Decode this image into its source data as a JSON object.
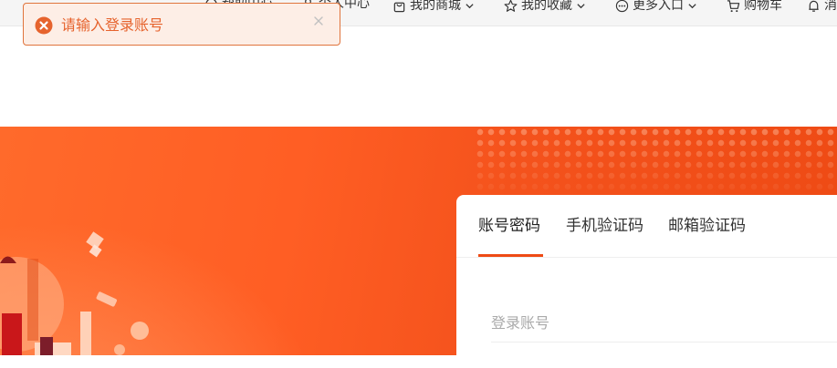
{
  "topbar": {
    "items": [
      {
        "label": "帮助中心"
      },
      {
        "label": "个人中心"
      },
      {
        "label": "我的商城"
      },
      {
        "label": "我的收藏"
      },
      {
        "label": "更多入口"
      },
      {
        "label": "购物车"
      },
      {
        "label": "消息"
      }
    ]
  },
  "toast": {
    "message": "请输入登录账号",
    "icon": "error-circle-icon",
    "color": "#e6632d"
  },
  "login": {
    "tabs": [
      {
        "label": "账号密码",
        "active": true
      },
      {
        "label": "手机验证码",
        "active": false
      },
      {
        "label": "邮箱验证码",
        "active": false
      }
    ],
    "account_placeholder": "登录账号"
  },
  "colors": {
    "accent": "#ee4a14",
    "banner": "#ff5e24"
  }
}
